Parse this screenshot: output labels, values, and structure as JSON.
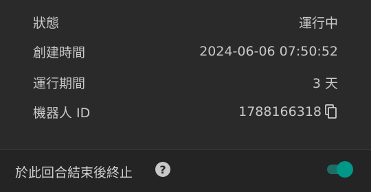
{
  "details": {
    "rows": [
      {
        "label": "狀態",
        "value": "運行中"
      },
      {
        "label": "創建時間",
        "value": "2024-06-06 07:50:52"
      },
      {
        "label": "運行期間",
        "value": "3 天"
      },
      {
        "label": "機器人 ID",
        "value": "1788166318"
      }
    ],
    "copy_icon": "copy-icon"
  },
  "footer": {
    "label": "於此回合結束後終止",
    "help_icon": "help-icon",
    "toggle_on": true,
    "toggle_color": "#009688"
  }
}
